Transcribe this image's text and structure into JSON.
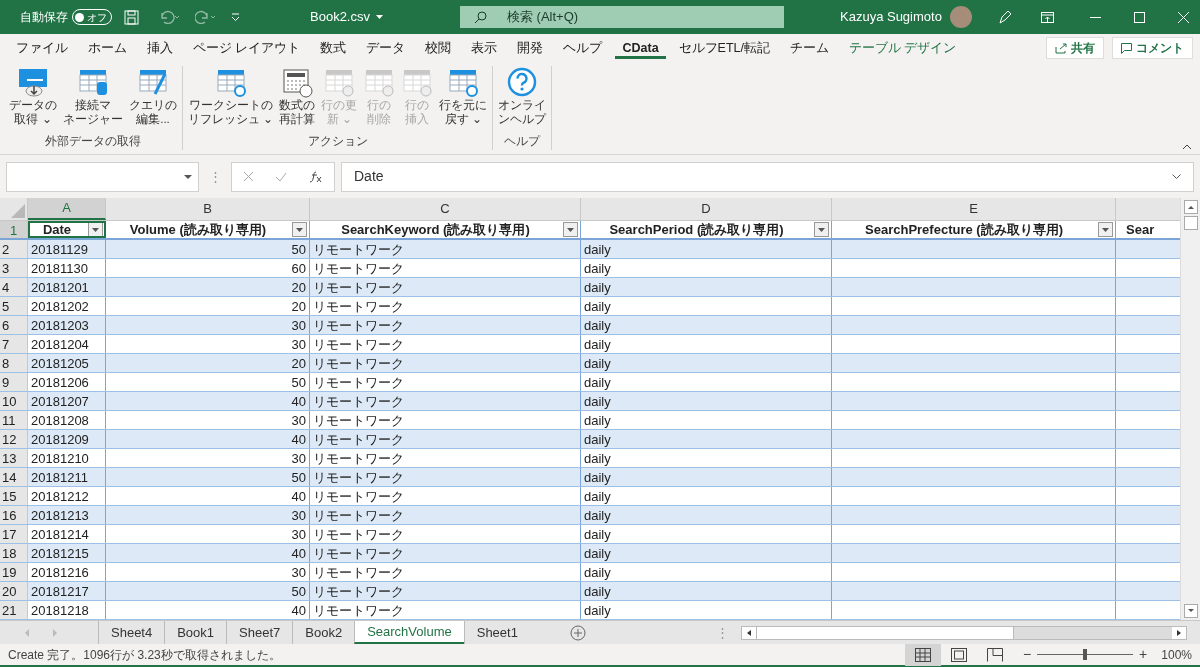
{
  "title_bar": {
    "autosave_label": "自動保存",
    "autosave_toggle": {
      "label": "オフ",
      "on": false
    },
    "file_name": "Book2.csv",
    "search_placeholder": "検索 (Alt+Q)",
    "user_name": "Kazuya Sugimoto"
  },
  "ribbon_tabs": [
    {
      "label": "ファイル",
      "selected": false
    },
    {
      "label": "ホーム",
      "selected": false
    },
    {
      "label": "挿入",
      "selected": false
    },
    {
      "label": "ページ レイアウト",
      "selected": false
    },
    {
      "label": "数式",
      "selected": false
    },
    {
      "label": "データ",
      "selected": false
    },
    {
      "label": "校閲",
      "selected": false
    },
    {
      "label": "表示",
      "selected": false
    },
    {
      "label": "開発",
      "selected": false
    },
    {
      "label": "ヘルプ",
      "selected": false
    },
    {
      "label": "CData",
      "selected": true
    },
    {
      "label": "セルフETL/転記",
      "selected": false
    },
    {
      "label": "チーム",
      "selected": false
    },
    {
      "label": "テーブル デザイン",
      "selected": false,
      "contextual": true
    }
  ],
  "share_button": "共有",
  "comment_button": "コメント",
  "ribbon_groups": [
    {
      "label": "外部データの取得",
      "buttons": [
        {
          "kind": "cloud",
          "lines": [
            "データの",
            "取得 ⌄"
          ],
          "disabled": false
        },
        {
          "kind": "db",
          "lines": [
            "接続マ",
            "ネージャー"
          ],
          "disabled": false
        },
        {
          "kind": "edit",
          "lines": [
            "クエリの",
            "編集..."
          ],
          "disabled": false
        }
      ]
    },
    {
      "label": "アクション",
      "buttons": [
        {
          "kind": "refresh",
          "lines": [
            "ワークシートの",
            "リフレッシュ ⌄"
          ],
          "disabled": false
        },
        {
          "kind": "calc",
          "lines": [
            "数式の",
            "再計算"
          ],
          "disabled": false
        },
        {
          "kind": "update",
          "lines": [
            "行の更",
            "新 ⌄"
          ],
          "disabled": true
        },
        {
          "kind": "delete",
          "lines": [
            "行の",
            "削除"
          ],
          "disabled": true
        },
        {
          "kind": "insert",
          "lines": [
            "行の",
            "挿入"
          ],
          "disabled": true
        },
        {
          "kind": "undo",
          "lines": [
            "行を元に",
            "戻す ⌄"
          ],
          "disabled": false
        }
      ]
    },
    {
      "label": "ヘルプ",
      "buttons": [
        {
          "kind": "help",
          "lines": [
            "オンライ",
            "ンヘルプ"
          ],
          "disabled": false
        }
      ]
    }
  ],
  "formula_bar": {
    "separator": "⋮",
    "value": "Date"
  },
  "sheet_splitter": "⋮",
  "columns": [
    {
      "letter": "A",
      "header": "Date",
      "selected": true
    },
    {
      "letter": "B",
      "header": "Volume (読み取り専用)",
      "selected": false
    },
    {
      "letter": "C",
      "header": "SearchKeyword (読み取り専用)",
      "selected": false
    },
    {
      "letter": "D",
      "header": "SearchPeriod (読み取り専用)",
      "selected": false
    },
    {
      "letter": "E",
      "header": "SearchPrefecture (読み取り専用)",
      "selected": false
    },
    {
      "header": "Sear",
      "selected": false
    }
  ],
  "rows": [
    [
      "20181129",
      "50",
      "リモートワーク",
      "daily"
    ],
    [
      "20181130",
      "60",
      "リモートワーク",
      "daily"
    ],
    [
      "20181201",
      "20",
      "リモートワーク",
      "daily"
    ],
    [
      "20181202",
      "20",
      "リモートワーク",
      "daily"
    ],
    [
      "20181203",
      "30",
      "リモートワーク",
      "daily"
    ],
    [
      "20181204",
      "30",
      "リモートワーク",
      "daily"
    ],
    [
      "20181205",
      "20",
      "リモートワーク",
      "daily"
    ],
    [
      "20181206",
      "50",
      "リモートワーク",
      "daily"
    ],
    [
      "20181207",
      "40",
      "リモートワーク",
      "daily"
    ],
    [
      "20181208",
      "30",
      "リモートワーク",
      "daily"
    ],
    [
      "20181209",
      "40",
      "リモートワーク",
      "daily"
    ],
    [
      "20181210",
      "30",
      "リモートワーク",
      "daily"
    ],
    [
      "20181211",
      "50",
      "リモートワーク",
      "daily"
    ],
    [
      "20181212",
      "40",
      "リモートワーク",
      "daily"
    ],
    [
      "20181213",
      "30",
      "リモートワーク",
      "daily"
    ],
    [
      "20181214",
      "30",
      "リモートワーク",
      "daily"
    ],
    [
      "20181215",
      "40",
      "リモートワーク",
      "daily"
    ],
    [
      "20181216",
      "30",
      "リモートワーク",
      "daily"
    ],
    [
      "20181217",
      "50",
      "リモートワーク",
      "daily"
    ],
    [
      "20181218",
      "40",
      "リモートワーク",
      "daily"
    ]
  ],
  "row_numbers": [
    "1",
    "2",
    "3",
    "4",
    "5",
    "6",
    "7",
    "8",
    "9",
    "10",
    "11",
    "12",
    "13",
    "14",
    "15",
    "16",
    "17",
    "18",
    "19",
    "20",
    "21"
  ],
  "sheet_tabs": [
    {
      "label": "Sheet4",
      "selected": false
    },
    {
      "label": "Book1",
      "selected": false
    },
    {
      "label": "Sheet7",
      "selected": false
    },
    {
      "label": "Book2",
      "selected": false
    },
    {
      "label": "SearchVolume",
      "selected": true
    },
    {
      "label": "Sheet1",
      "selected": false
    }
  ],
  "status_bar": {
    "message": "Create 完了。1096行が 3.23秒で取得されました。",
    "views": [
      {
        "kind": "normal",
        "selected": true
      },
      {
        "kind": "layout",
        "selected": false
      },
      {
        "kind": "pagebreak",
        "selected": false
      }
    ],
    "zoom": {
      "minus": "−",
      "plus": "+",
      "level": 0.5,
      "reading": "100%"
    }
  }
}
